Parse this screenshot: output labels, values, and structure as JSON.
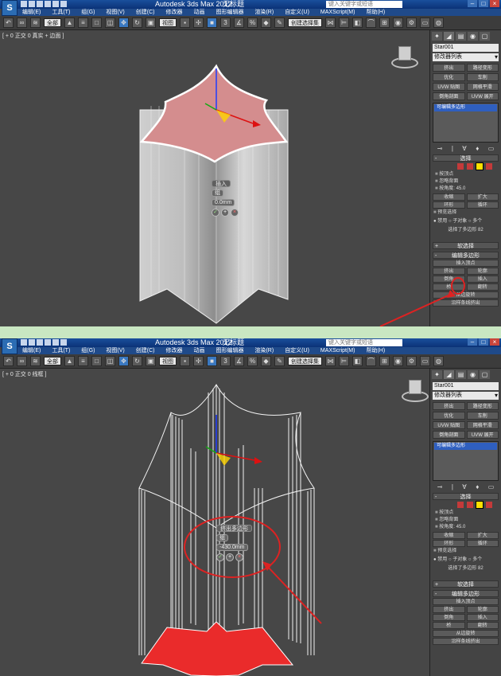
{
  "app": {
    "logo": "S",
    "title": "Autodesk 3ds Max  2012",
    "title_file": "无标题",
    "search_placeholder": "键入关键字或短语",
    "menu": [
      "编辑(E)",
      "工具(T)",
      "组(G)",
      "视图(V)",
      "创建(C)",
      "修改器",
      "动画",
      "图形编辑器",
      "渲染(R)",
      "自定义(U)",
      "MAXScript(M)",
      "帮助(H)"
    ],
    "toolbar": {
      "filter": "全部",
      "viewref": "视图",
      "selset": "创建选择集"
    }
  },
  "shot_a": {
    "viewport_label": "[ + 0 正交 0 真实 + 边面 ]",
    "caddy": {
      "title": "插入",
      "mode": "组",
      "amount": "0.0mm"
    },
    "panel": {
      "object_name": "Star001",
      "modifier_list": "修改器列表",
      "mod_buttons": [
        "挤出",
        "路径变形",
        "优化",
        "车削",
        "UVW 贴图",
        "网格平滑",
        "倒角剖面",
        "UVW 展开"
      ],
      "stack_item": "可编辑多边形",
      "selection_title": "选择",
      "checks": [
        "按顶点",
        "忽略背面",
        "按角度: 45.0"
      ],
      "shrink_grow": [
        "收缩",
        "扩大"
      ],
      "ring_loop": [
        "环形",
        "循环"
      ],
      "preview_title": "预览选择",
      "preview_radios": "● 禁用  ○ 子对象  ○ 多个",
      "status": "选择了多边形 82",
      "soft_sel": "软选择",
      "edit_poly": "编辑多边形",
      "insert_vertex": "插入顶点",
      "ops": [
        [
          "挤出",
          "轮廓"
        ],
        [
          "倒角",
          "插入"
        ],
        [
          "桥",
          "翻转"
        ]
      ],
      "from_edge": "从边旋转",
      "along_spline": "沿样条线挤出"
    }
  },
  "shot_b": {
    "viewport_label": "[ + 0 正交 0 线框 ]",
    "caddy": {
      "title": "挤出多边形",
      "mode": "组",
      "amount": "-430.0mm"
    },
    "panel": {
      "object_name": "Star001",
      "modifier_list": "修改器列表",
      "mod_buttons": [
        "挤出",
        "路径变形",
        "优化",
        "车削",
        "UVW 贴图",
        "网格平滑",
        "倒角剖面",
        "UVW 展开"
      ],
      "stack_item": "可编辑多边形",
      "selection_title": "选择",
      "checks": [
        "按顶点",
        "忽略背面",
        "按角度: 45.0"
      ],
      "shrink_grow": [
        "收缩",
        "扩大"
      ],
      "ring_loop": [
        "环形",
        "循环"
      ],
      "preview_title": "预览选择",
      "preview_radios": "● 禁用  ○ 子对象  ○ 多个",
      "status": "选择了多边形 82",
      "soft_sel": "软选择",
      "edit_poly": "编辑多边形",
      "insert_vertex": "插入顶点",
      "ops": [
        [
          "挤出",
          "轮廓"
        ],
        [
          "倒角",
          "插入"
        ],
        [
          "桥",
          "翻转"
        ]
      ],
      "from_edge": "从边旋转",
      "along_spline": "沿样条线挤出"
    }
  },
  "colors": {
    "highlight_red": "#dd2222",
    "face_pink": "#d98c8c",
    "title_blue": "#0b3277"
  }
}
